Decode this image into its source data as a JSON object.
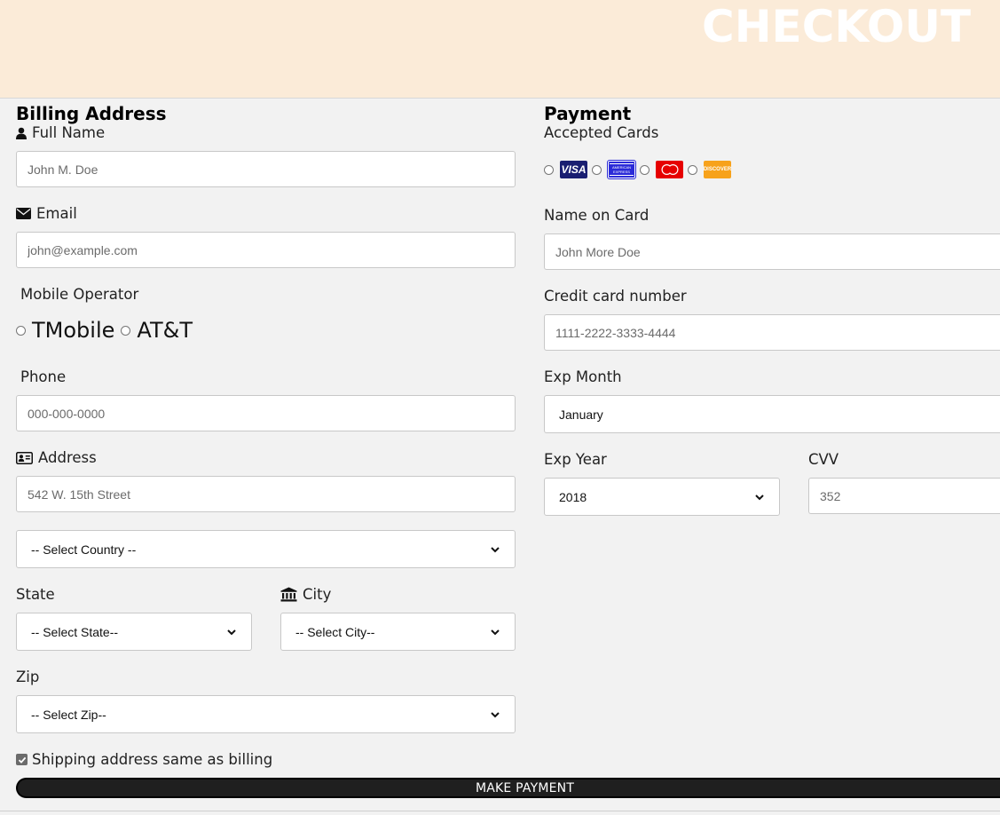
{
  "header": {
    "title": "CHECKOUT"
  },
  "billing": {
    "title": "Billing Address",
    "full_name": {
      "label": "Full Name",
      "placeholder": "John M. Doe"
    },
    "email": {
      "label": "Email",
      "placeholder": "john@example.com"
    },
    "mobile_operator": {
      "label": "Mobile Operator",
      "options": [
        "TMobile",
        "AT&T"
      ]
    },
    "phone": {
      "label": "Phone",
      "placeholder": "000-000-0000"
    },
    "address": {
      "label": "Address",
      "placeholder": "542 W. 15th Street"
    },
    "country": {
      "selected": "-- Select Country --"
    },
    "state": {
      "label": "State",
      "selected": "-- Select State--"
    },
    "city": {
      "label": "City",
      "selected": "-- Select City--"
    },
    "zip": {
      "label": "Zip",
      "selected": "-- Select Zip--"
    },
    "shipping_same": {
      "label": "Shipping address same as billing",
      "checked": true
    }
  },
  "payment": {
    "title": "Payment",
    "accepted_cards": {
      "label": "Accepted Cards",
      "cards": [
        {
          "name": "VISA",
          "icon": "visa-icon",
          "color": "#1a1f71"
        },
        {
          "name": "AMERICAN EXPRESS",
          "icon": "amex-icon",
          "color": "#2b2bd8"
        },
        {
          "name": "mastercard",
          "icon": "mastercard-icon",
          "color": "#e60000"
        },
        {
          "name": "DISCOVER",
          "icon": "discover-icon",
          "color": "#f7a21b"
        }
      ]
    },
    "name_on_card": {
      "label": "Name on Card",
      "placeholder": "John More Doe"
    },
    "card_number": {
      "label": "Credit card number",
      "placeholder": "1111-2222-3333-4444"
    },
    "exp_month": {
      "label": "Exp Month",
      "value": "January"
    },
    "exp_year": {
      "label": "Exp Year",
      "selected": "2018"
    },
    "cvv": {
      "label": "CVV",
      "placeholder": "352"
    }
  },
  "actions": {
    "make_payment": "MAKE PAYMENT"
  },
  "colors": {
    "header_bg": "#fbebd8",
    "page_bg": "#f2f2f2",
    "button_bg": "#1f1f1f"
  }
}
